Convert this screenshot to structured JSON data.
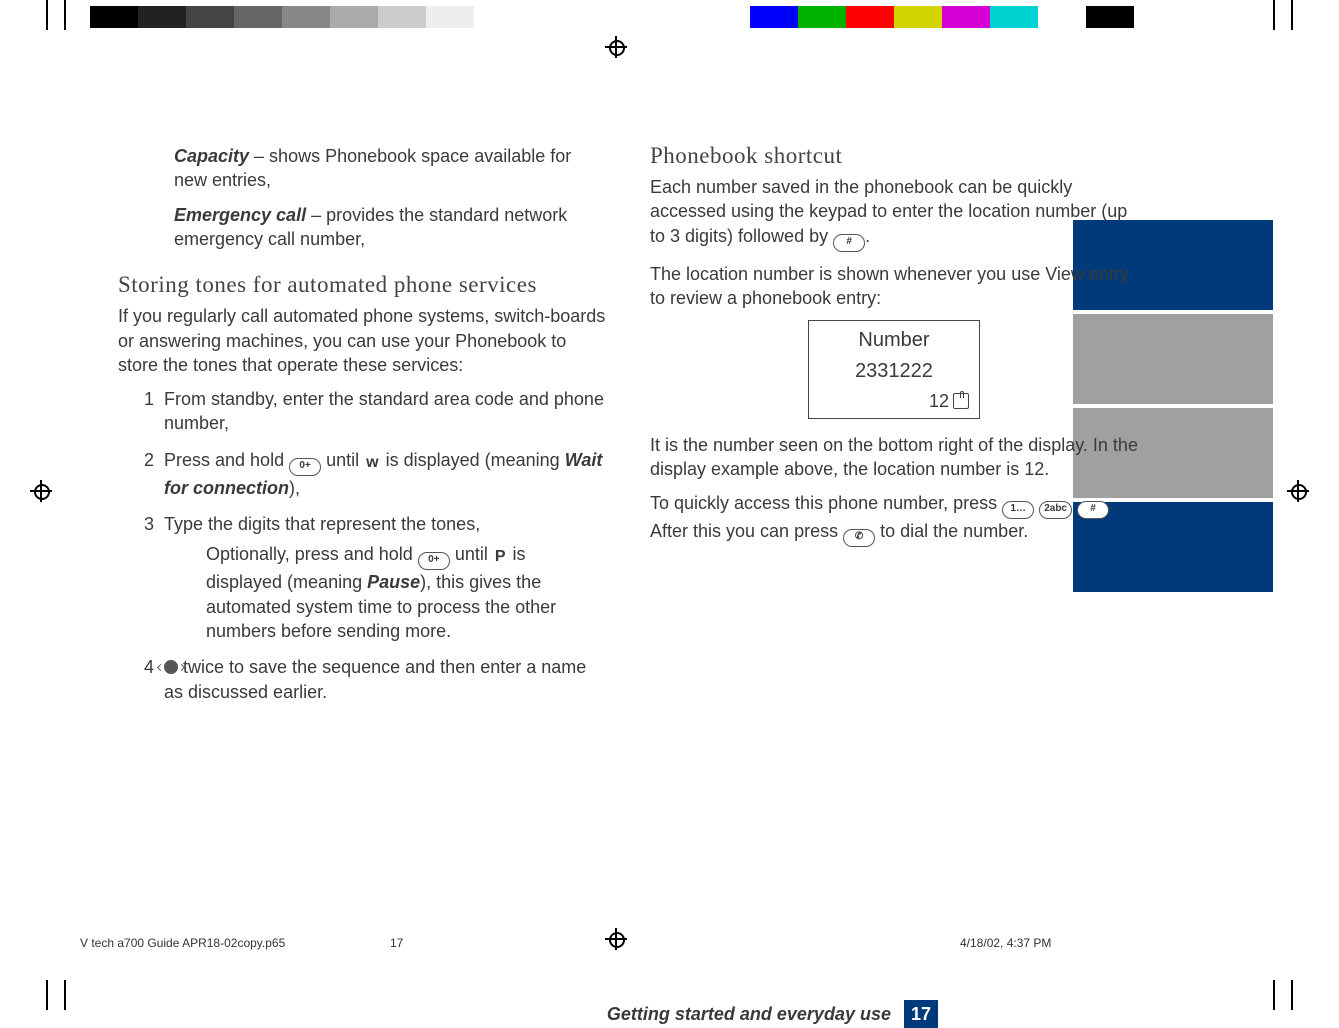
{
  "left": {
    "capacity_label": "Capacity",
    "capacity_text": " – shows Phonebook space available for new entries,",
    "emerg_label": "Emergency call",
    "emerg_text": " – provides the standard network emergency call number,",
    "heading": "Storing tones for automated phone services",
    "lead": "If you regularly call automated phone systems, switch-boards or answering machines, you can use your Phonebook to store the tones that operate these services:",
    "steps": [
      "From standby, enter the standard area code and phone number,",
      "Press and hold ⓪ until ⓦ is displayed (meaning Wait for connection),",
      "Type the digits that represent the tones,",
      "◀●▶ twice to save the sequence and then enter a name as discussed earlier."
    ],
    "step2_pre": "Press and hold ",
    "step2_mid": " until ",
    "step2_glyph": "w",
    "step2_post": " is displayed (meaning ",
    "step2_ital": "Wait for connection",
    "step2_end": "),",
    "step3_sub_pre": "Optionally, press and hold ",
    "step3_sub_mid": " until ",
    "step3_sub_glyph": "P",
    "step3_sub_post": " is displayed (meaning ",
    "step3_sub_bold": "Pause",
    "step3_sub_end": "), this gives the automated system time to process the other numbers before sending more.",
    "step4_post": " twice to save the sequence and then enter a name as discussed earlier.",
    "key0": "0+"
  },
  "right": {
    "heading": "Phonebook shortcut",
    "p1_pre": "Each number saved in the phonebook can be quickly accessed using the keypad to enter the location number (up to 3 digits) followed by ",
    "p1_end": ".",
    "p2": "The location number is shown whenever you use View entry to review a phonebook entry:",
    "screen_title": "Number",
    "screen_number": "2331222",
    "screen_loc": "12",
    "p3": "It is the number seen on the bottom right of the display. In the display example above, the location number is 12.",
    "p4_pre": "To quickly access this phone number, press ",
    "p4_post": ". After this you can press ",
    "p4_end": " to dial the number.",
    "key_hash": "#",
    "key_1": "1…",
    "key_2": "2abc",
    "key_call": "✆"
  },
  "footer": {
    "text": "Getting started and everyday use",
    "page": "17"
  },
  "slug": {
    "file": "V tech a700 Guide APR18-02copy.p65",
    "page": "17",
    "stamp": "4/18/02, 4:37 PM"
  },
  "colorbar": [
    "#0000ff",
    "#00b200",
    "#ff0000",
    "#d4d400",
    "#d400d4",
    "#00d2d2",
    "#ffffff",
    "#000000"
  ],
  "graybar": [
    "#000",
    "#222",
    "#444",
    "#666",
    "#888",
    "#aaa",
    "#ccc",
    "#eee"
  ],
  "edge": [
    "#003a7a",
    "#a0a0a0",
    "#a0a0a0",
    "#003a7a"
  ]
}
